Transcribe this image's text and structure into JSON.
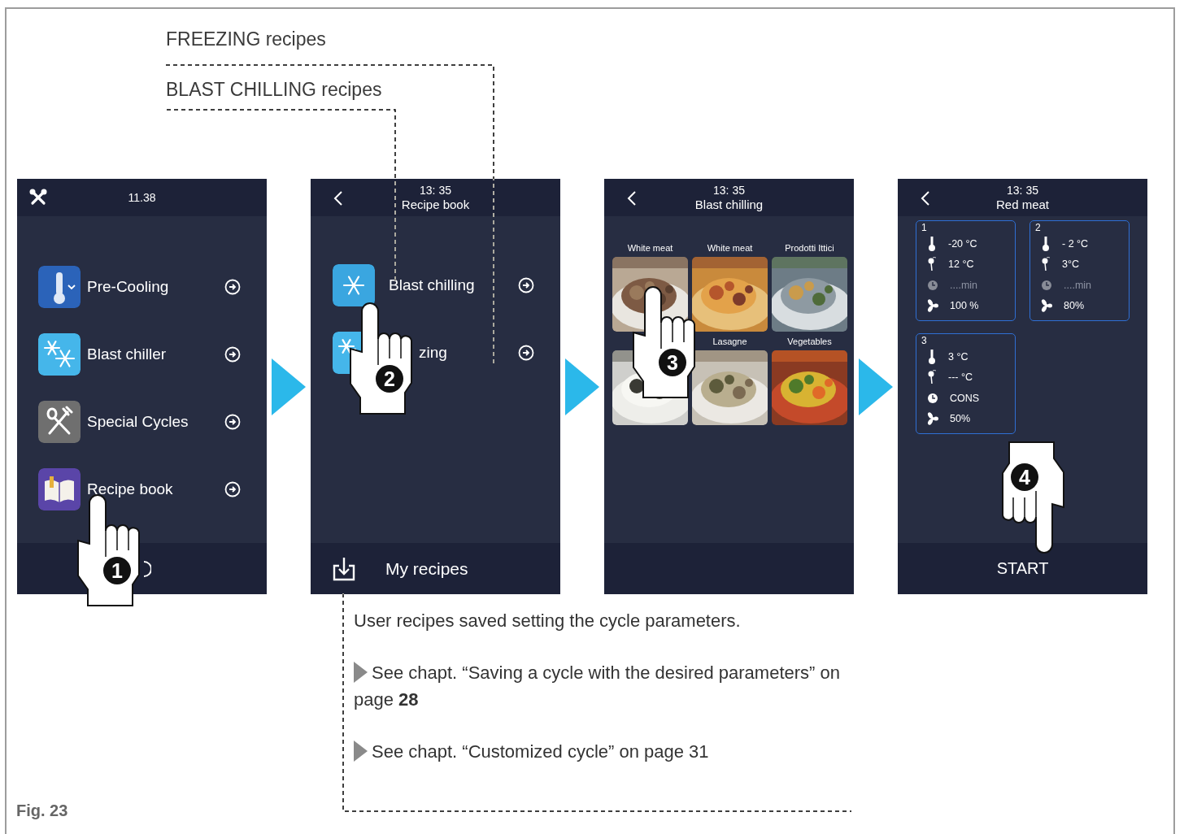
{
  "callouts": [
    "FREEZING recipes",
    "BLAST CHILLING recipes"
  ],
  "screens": [
    {
      "kind": "menu",
      "header": {
        "time": "11.38"
      },
      "items": [
        {
          "label": "Pre-Cooling",
          "kind": "thermometer"
        },
        {
          "label": "Blast chiller",
          "kind": "snowflakes"
        },
        {
          "label": "Special Cycles",
          "kind": "cutlery"
        },
        {
          "label": "Recipe book",
          "kind": "book"
        }
      ],
      "hand": "1"
    },
    {
      "kind": "list",
      "header": {
        "time": "13: 35",
        "title": "Recipe book"
      },
      "items": [
        {
          "label": "Blast chilling",
          "kind": "snowflake"
        },
        {
          "label": "zing",
          "kind": "snowflakes"
        }
      ],
      "footer": "My recipes",
      "hand": "2"
    },
    {
      "kind": "gallery",
      "header": {
        "time": "13: 35",
        "title": "Blast chilling"
      },
      "tiles": [
        {
          "label": "White meat",
          "kind": "picture"
        },
        {
          "label": "White meat",
          "kind": "picture"
        },
        {
          "label": "Prodotti Ittici",
          "kind": "picture"
        },
        {
          "kind": "picture"
        },
        {
          "label": "Lasagne",
          "kind": "picture"
        },
        {
          "label": "Vegetables",
          "kind": "picture"
        }
      ],
      "hand": "3"
    },
    {
      "kind": "steps",
      "header": {
        "time": "13: 35",
        "title": "Red meat"
      },
      "steps": [
        {
          "number": "1",
          "rows": [
            {
              "kind": "temperature",
              "value": "-20 °C",
              "dimmed": false
            },
            {
              "kind": "probe",
              "value": "12 °C",
              "dimmed": false
            },
            {
              "kind": "timer",
              "value": "....min",
              "dimmed": true
            },
            {
              "kind": "fan",
              "value": "100 %",
              "dimmed": false
            }
          ]
        },
        {
          "number": "2",
          "rows": [
            {
              "kind": "temperature",
              "value": "- 2 °C",
              "dimmed": false
            },
            {
              "kind": "probe",
              "value": "3°C",
              "dimmed": false
            },
            {
              "kind": "timer",
              "value": "....min",
              "dimmed": true
            },
            {
              "kind": "fan",
              "value": "80%",
              "dimmed": false
            }
          ]
        },
        {
          "number": "3",
          "rows": [
            {
              "kind": "temperature",
              "value": "3 °C",
              "dimmed": false
            },
            {
              "kind": "probe",
              "value": "--- °C",
              "dimmed": false
            },
            {
              "kind": "timer",
              "value": "CONS",
              "dimmed": false
            },
            {
              "kind": "fan",
              "value": "50%",
              "dimmed": false
            }
          ]
        }
      ],
      "footer": "START",
      "hand": "4"
    }
  ],
  "notes": [
    {
      "text": "User recipes saved setting the cycle parameters.",
      "bullet": false
    },
    {
      "text": "See chapt. “Saving a cycle with the desired parameters” on page **28**",
      "bullet": true
    },
    {
      "text": "See chapt. “Customized cycle” on page 31",
      "bullet": true
    }
  ],
  "figure_label": "Fig. 23"
}
